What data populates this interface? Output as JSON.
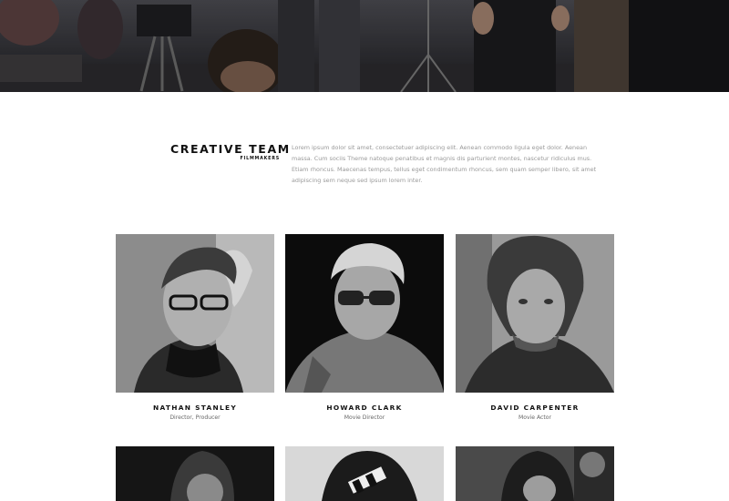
{
  "intro": {
    "title": "CREATIVE TEAM",
    "subtitle": "FILMMAKERS",
    "text": "Lorem ipsum dolor sit amet, consectetuer adipiscing elit. Aenean commodo ligula eget dolor. Aenean massa. Cum sociis Theme natoque penatibus et magnis dis parturient montes, nascetur ridiculus mus. Etiam rhoncus. Maecenas tempus, tellus eget condimentum rhoncus, sem quam semper libero, sit amet adipiscing sem neque sed ipsum lorem inter."
  },
  "team": [
    {
      "name": "NATHAN STANLEY",
      "role": "Director, Producer"
    },
    {
      "name": "HOWARD CLARK",
      "role": "Movie Director"
    },
    {
      "name": "DAVID CARPENTER",
      "role": "Movie Actor"
    }
  ],
  "colors": {
    "heading": "#111111",
    "body_text": "#9a9a9a",
    "role_text": "#666666",
    "background": "#ffffff"
  }
}
